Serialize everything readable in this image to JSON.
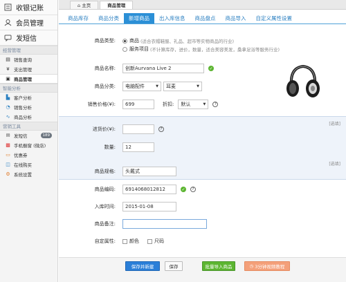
{
  "sidebar": {
    "top_items": [
      {
        "label": "收银记账",
        "icon": "cash-register-icon"
      },
      {
        "label": "会员管理",
        "icon": "member-icon"
      },
      {
        "label": "发短信",
        "icon": "sms-icon"
      }
    ],
    "sections": [
      {
        "title": "经营管理",
        "items": [
          {
            "label": "销售查询",
            "icon": "sales-query-icon"
          },
          {
            "label": "支出管理",
            "icon": "expense-icon"
          },
          {
            "label": "商品管理",
            "icon": "product-icon",
            "active": true
          }
        ]
      },
      {
        "title": "智能分析",
        "items": [
          {
            "label": "客户分析",
            "icon": "customer-analysis-icon"
          },
          {
            "label": "销售分析",
            "icon": "sales-analysis-icon"
          },
          {
            "label": "商品分析",
            "icon": "product-analysis-icon"
          }
        ]
      },
      {
        "title": "营销工具",
        "items": [
          {
            "label": "发短信",
            "icon": "sms-small-icon",
            "badge": "189"
          },
          {
            "label": "手机橱窗 (微店)",
            "icon": "phone-shop-icon"
          },
          {
            "label": "优惠券",
            "icon": "coupon-icon"
          },
          {
            "label": "在线购买",
            "icon": "online-buy-icon"
          },
          {
            "label": "系统设置",
            "icon": "settings-icon"
          }
        ]
      }
    ]
  },
  "top_tabs": [
    {
      "label": "主页",
      "icon": "home-icon"
    },
    {
      "label": "商品管理",
      "active": true
    }
  ],
  "sub_tabs": [
    "商品库存",
    "商品分类",
    "新增商品",
    "出入库信息",
    "商品盘点",
    "商品导入",
    "自定义属性设置"
  ],
  "sub_tab_active": "新增商品",
  "form": {
    "type_label": "商品类型:",
    "type_goods": "商品",
    "type_goods_note": "(适合衣帽鞋服、礼品、超市等实物商品的行业)",
    "type_service": "服务项目",
    "type_service_note": "(不计算库存，进价，数量，适合美容美发，桑拿足浴等服务行业)",
    "name_label": "商品名称:",
    "name_value": "创新Aurvana Live 2",
    "category_label": "商品分类:",
    "category_value": "电脑配件",
    "subcategory_value": "耳麦",
    "price_label": "销售价格(¥):",
    "price_value": "699",
    "discount_label": "折扣:",
    "discount_value": "默认",
    "cost_label": "进货价(¥):",
    "cost_value": "",
    "qty_label": "数量:",
    "qty_value": "12",
    "optional_label": "[选填]",
    "spec_label": "商品规格:",
    "spec_value": "头戴式",
    "code_label": "商品编码:",
    "code_value": "6914068012812",
    "date_label": "入库时间:",
    "date_value": "2015-01-08",
    "remark_label": "商品备注:",
    "remark_value": "",
    "custom_label": "自定属性:",
    "custom_color": "颜色",
    "custom_size": "尺码"
  },
  "buttons": {
    "save_new": "保存并新建",
    "save": "保存",
    "bulk_import": "批量导入商品",
    "video": "3分钟视频教程"
  },
  "colors": {
    "accent": "#2b8fd6",
    "ok_green": "#5cb531",
    "band": "#eef3fa"
  }
}
